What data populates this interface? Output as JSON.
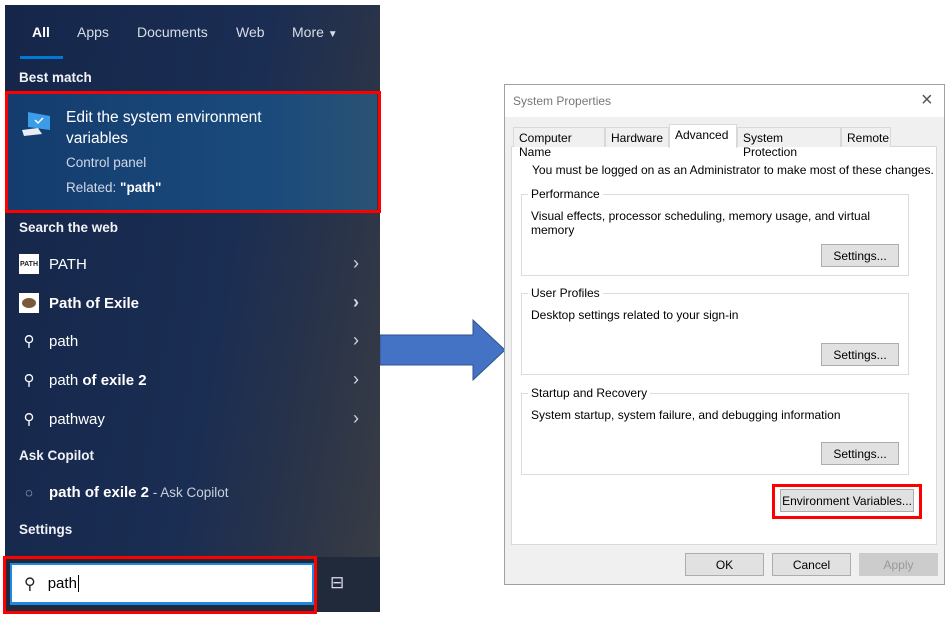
{
  "search_panel": {
    "tabs": [
      "All",
      "Apps",
      "Documents",
      "Web",
      "More"
    ],
    "active_tab": "All",
    "best_match_heading": "Best match",
    "best_match": {
      "title_line1": "Edit the system environment",
      "title_line2": "variables",
      "subtitle": "Control panel",
      "related_prefix": "Related: ",
      "related_value": "\"path\"",
      "icon": "monitor-settings-icon"
    },
    "web_heading": "Search the web",
    "web_items": [
      {
        "label": "PATH",
        "icon": "path-logo-icon"
      },
      {
        "label": "Path of Exile",
        "icon": "path-of-exile-logo-icon"
      },
      {
        "label": "path",
        "icon": "search-icon"
      },
      {
        "label_plain": "path",
        "label_bold": " of exile 2",
        "icon": "search-icon"
      },
      {
        "label": "pathway",
        "icon": "search-icon"
      }
    ],
    "copilot_heading": "Ask Copilot",
    "copilot_item": {
      "query": "path of exile 2",
      "suffix": " - Ask Copilot",
      "icon": "chat-icon"
    },
    "settings_heading": "Settings",
    "search_value": "path",
    "accent": "#0078d4",
    "highlight": "#ff0000"
  },
  "dialog": {
    "title": "System Properties",
    "tabs": [
      "Computer Name",
      "Hardware",
      "Advanced",
      "System Protection",
      "Remote"
    ],
    "active_tab": "Advanced",
    "admin_note": "You must be logged on as an Administrator to make most of these changes.",
    "groups": [
      {
        "label": "Performance",
        "description": "Visual effects, processor scheduling, memory usage, and virtual memory",
        "button": "Settings..."
      },
      {
        "label": "User Profiles",
        "description": "Desktop settings related to your sign-in",
        "button": "Settings..."
      },
      {
        "label": "Startup and Recovery",
        "description": "System startup, system failure, and debugging information",
        "button": "Settings..."
      }
    ],
    "env_button": "Environment Variables...",
    "ok": "OK",
    "cancel": "Cancel",
    "apply": "Apply"
  },
  "arrow_color": "#4472c4"
}
